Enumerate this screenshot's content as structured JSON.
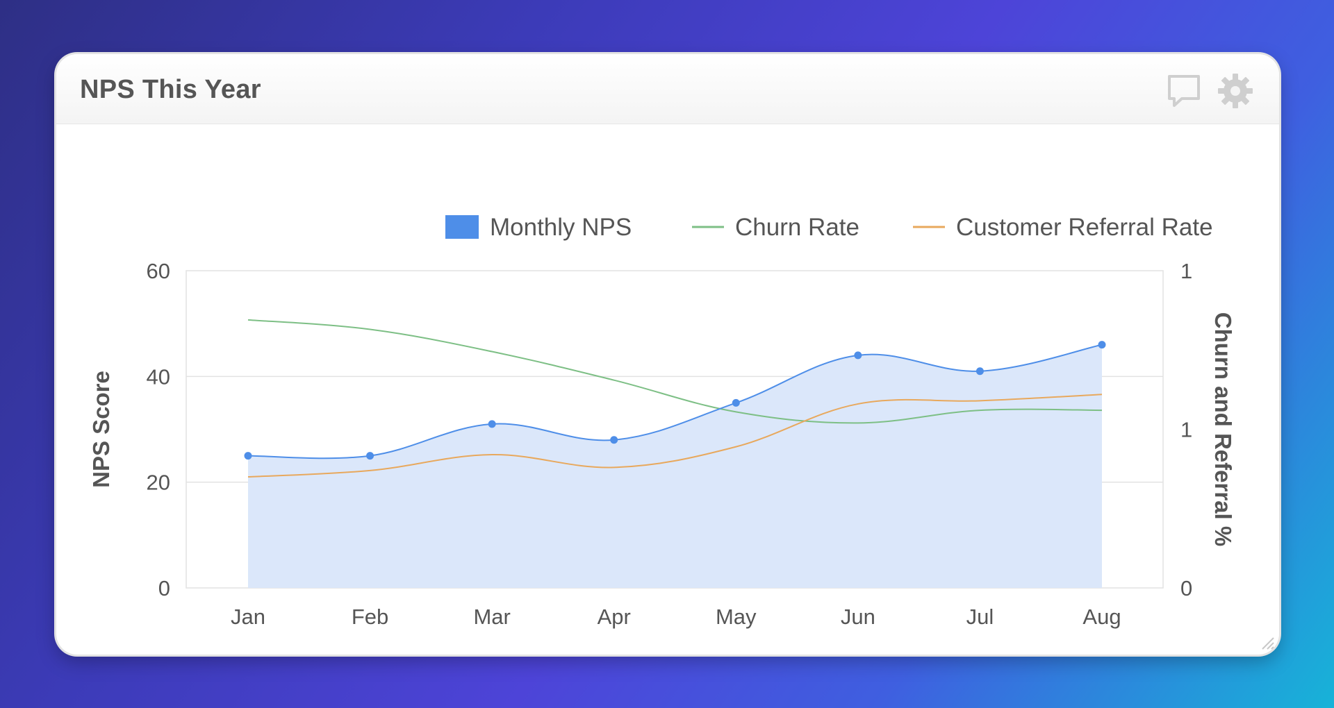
{
  "widget": {
    "title": "NPS This Year"
  },
  "icons": {
    "comment": "comment-icon",
    "settings": "gear-icon",
    "resize": "resize-grip-icon"
  },
  "colors": {
    "nps": "#4e8ee8",
    "nps_fill": "#dbe7fa",
    "churn": "#7dbf85",
    "referral": "#e8a85c",
    "axis_text": "#555555",
    "grid": "#e2e2e2"
  },
  "chart_data": {
    "type": "line",
    "title": "",
    "categories": [
      "Jan",
      "Feb",
      "Mar",
      "Apr",
      "May",
      "Jun",
      "Jul",
      "Aug"
    ],
    "series": [
      {
        "name": "Monthly NPS",
        "kind": "area",
        "axis": "left",
        "values": [
          25,
          25,
          31,
          28,
          35,
          44,
          41,
          46
        ]
      },
      {
        "name": "Churn Rate",
        "kind": "line",
        "axis": "right",
        "values": [
          1.69,
          1.63,
          1.49,
          1.31,
          1.11,
          1.04,
          1.12,
          1.12
        ]
      },
      {
        "name": "Customer Referral Rate",
        "kind": "line",
        "axis": "right",
        "values": [
          0.7,
          0.74,
          0.84,
          0.76,
          0.89,
          1.16,
          1.18,
          1.22
        ]
      }
    ],
    "y_left": {
      "label": "NPS Score",
      "ylim": [
        0,
        60
      ],
      "ticks": [
        "0",
        "20",
        "40",
        "60"
      ]
    },
    "y_right": {
      "label": "Churn and Referral %",
      "ylim": [
        0,
        2
      ],
      "tick_values": [
        0,
        1,
        2
      ],
      "ticks": [
        "0",
        "1",
        "1"
      ]
    },
    "grid": true,
    "legend_position": "top-right"
  }
}
